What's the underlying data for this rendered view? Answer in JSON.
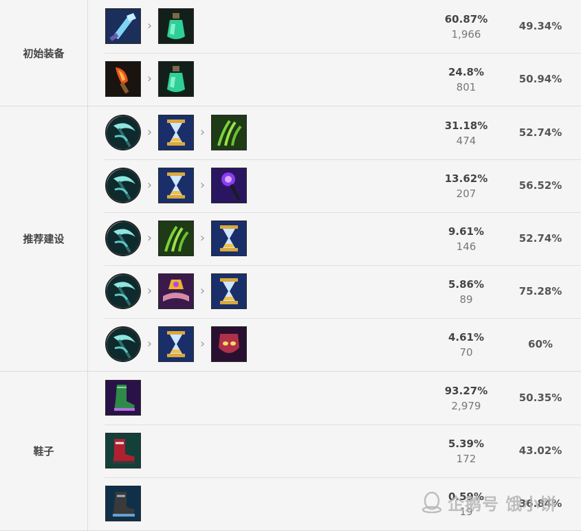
{
  "sections": [
    {
      "label": "初始装备",
      "rows": [
        {
          "items": [
            "blade-icon",
            "potion-icon"
          ],
          "pick_rate": "60.87%",
          "count": "1,966",
          "win_rate": "49.34%"
        },
        {
          "items": [
            "ember-knife-icon",
            "potion-icon"
          ],
          "pick_rate": "24.8%",
          "count": "801",
          "win_rate": "50.94%"
        }
      ]
    },
    {
      "label": "推荐建设",
      "rows": [
        {
          "items": [
            "scythe-icon",
            "hourglass-icon",
            "claw-icon"
          ],
          "pick_rate": "31.18%",
          "count": "474",
          "win_rate": "52.74%"
        },
        {
          "items": [
            "scythe-icon",
            "hourglass-icon",
            "void-staff-icon"
          ],
          "pick_rate": "13.62%",
          "count": "207",
          "win_rate": "56.52%"
        },
        {
          "items": [
            "scythe-icon",
            "claw-icon",
            "hourglass-icon"
          ],
          "pick_rate": "9.61%",
          "count": "146",
          "win_rate": "52.74%"
        },
        {
          "items": [
            "scythe-icon",
            "spellbook-icon",
            "hourglass-icon"
          ],
          "pick_rate": "5.86%",
          "count": "89",
          "win_rate": "75.28%"
        },
        {
          "items": [
            "scythe-icon",
            "hourglass-icon",
            "mask-icon"
          ],
          "pick_rate": "4.61%",
          "count": "70",
          "win_rate": "60%"
        }
      ]
    },
    {
      "label": "鞋子",
      "rows": [
        {
          "items": [
            "green-boots-icon"
          ],
          "pick_rate": "93.27%",
          "count": "2,979",
          "win_rate": "50.35%"
        },
        {
          "items": [
            "red-boots-icon"
          ],
          "pick_rate": "5.39%",
          "count": "172",
          "win_rate": "43.02%"
        },
        {
          "items": [
            "steel-boots-icon"
          ],
          "pick_rate": "0.59%",
          "count": "19",
          "win_rate": "36.84%"
        }
      ]
    }
  ],
  "watermark": {
    "text": "企鹅号 饿小饼"
  },
  "colors": {
    "background": "#f5f5f5",
    "border": "#dcdcdc",
    "text": "#555555"
  }
}
